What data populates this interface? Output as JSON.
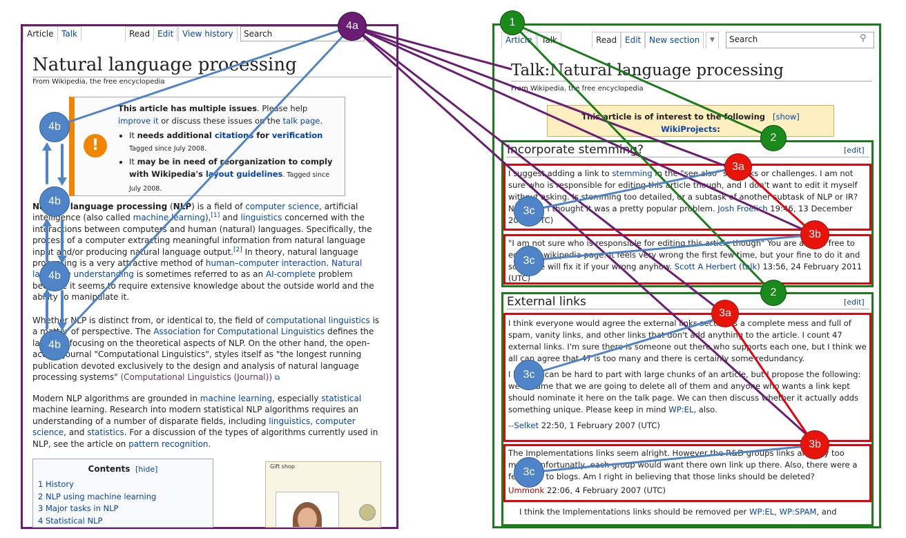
{
  "left": {
    "tabs": {
      "article": "Article",
      "talk": "Talk",
      "read": "Read",
      "edit": "Edit",
      "history": "View history"
    },
    "search_placeholder": "Search",
    "title": "Natural language processing",
    "subtitle": "From Wikipedia, the free encyclopedia",
    "issues": {
      "head_bold": "This article has multiple issues",
      "head_rest": ". Please help",
      "improve": "improve it",
      "or": " or discuss these issues on the ",
      "talk": "talk page",
      "dot": ".",
      "b1_a": "It ",
      "b1_b": "needs additional ",
      "b1_cit": "citations",
      "b1_for": " for ",
      "b1_ver": "verification",
      "b1_tag": "Tagged since July 2008.",
      "b2_a": "It ",
      "b2_b": "may be in need of reorganization to comply with Wikipedia's ",
      "b2_lay": "layout guidelines",
      "b2_tag": ". Tagged since July 2008."
    },
    "p1": {
      "t1": "Natural language processing",
      "t2": " (",
      "t3": "NLP",
      "t4": ") is a field of ",
      "cs": "computer science",
      "t5": ", artificial intelligence (also called ",
      "ml": "machine learning",
      "t6": "),",
      "ref1": "[1]",
      "t7": " and ",
      "ling": "linguistics",
      "t8": " concerned with the interactions between computers and human (natural) languages. Specifically, the process of a computer extracting meaningful information from natural language input and/or producing natural language output.",
      "ref2": "[2]",
      "t9": " In theory, natural language processing is a very attractive method of ",
      "hci": "human–computer interaction",
      "t10": ". ",
      "nlu": "Natural language understanding",
      "t11": " is sometimes referred to as an ",
      "aic": "AI-complete",
      "t12": " problem because it seems to require extensive knowledge about the outside world and the ability to manipulate it."
    },
    "p2": {
      "t1": "Whether NLP is distinct from, or identical to, the field of ",
      "cl": "computational linguistics",
      "t2": " is a matter of perspective. The ",
      "acl": "Association for Computational Linguistics",
      "t3": " defines the latter as focusing on the theoretical aspects of NLP. On the other hand, the open-access journal \"Computational Linguistics\", styles itself as \"the longest running publication devoted exclusively to the design and analysis of natural language processing systems\" ",
      "clj": "(Computational Linguistics (Journal))"
    },
    "p3": {
      "t1": "Modern NLP algorithms are grounded in ",
      "ml": "machine learning",
      "t2": ", especially ",
      "st": "statistical",
      "t3": " machine learning. Research into modern statistical NLP algorithms requires an understanding of a number of disparate fields, including ",
      "ling": "linguistics",
      "t4": ", ",
      "cs": "computer science",
      "t5": ", and ",
      "stats": "statistics",
      "t6": ". For a discussion of the types of algorithms currently used in NLP, see the article on ",
      "pr": "pattern recognition",
      "t7": "."
    },
    "toc": {
      "title": "Contents",
      "hide": "[hide]",
      "items": [
        "1 History",
        "2 NLP using machine learning",
        "3 Major tasks in NLP",
        "4 Statistical NLP"
      ]
    },
    "gift": {
      "title": "Gift shop"
    }
  },
  "right": {
    "tabs": {
      "article": "Article",
      "talk": "Talk",
      "read": "Read",
      "edit": "Edit",
      "newsec": "New section"
    },
    "search_placeholder": "Search",
    "title": "Talk:Natural language processing",
    "subtitle": "From Wikipedia, the free encyclopedia",
    "banner": {
      "text": "This article is of interest to the following",
      "show": "[show]",
      "wp": "WikiProjects",
      ":": ":"
    },
    "s1": {
      "title": "Incorporate stemming?",
      "edit": "[edit]",
      "c1": {
        "t1": "I suggest adding a link to ",
        "stem": "stemming",
        "t2": " in the \"see also\" subtasks or challenges. I am not sure who is responsible for editing this article though, and I don't want to edit it myself without asking. Is stemming too detailed, or a subtask of another subtask of NLP or IR? Not sure, I thought it was a pretty popular problem. ",
        "user": "Josh Froelich",
        "t3": " 19:46, 13 December 2006 (UTC)"
      },
      "c2": {
        "t1": "\"I am not sure who is responsible for editing this article though\" You are all feel free to edit any wikipedia page. It feels very wrong the first few time, but your fine to do it and someone will fix it if your wrong anyhow. ",
        "user": "Scott A Herbert",
        "t2": " (",
        "talk": "talk",
        "t3": ") 13:56, 24 February 2011 (UTC)"
      }
    },
    "s2": {
      "title": "External links",
      "edit": "[edit]",
      "c1": {
        "t1": "I think everyone would agree the external links section is a complete mess and full of spam, vanity links, and other links that don't add anything to the article. I count 47 external links. I'm sure there is someone out there who supports each one, but I think we all can agree that 47 is too many and there is certainly some redundancy.",
        "t2": "I know it can be hard to part with large chunks of an article, but I propose the following: we assume that we are going to delete all of them and anyone who wants a link kept should nominate it here on the talk page. We can then discuss whether it actually adds something unique. Please keep in mind ",
        "wpel": "WP:EL",
        "t3": ", also.",
        "sig_pre": "--",
        "user": "Selket",
        "t4": " 22:50, 1 February 2007 (UTC)"
      },
      "c2": {
        "t1": "The Implementations links seem alright. However the R&D groups links are way too many. Unfortunatly, each group would want there own link up there. Also, there were a few links to blogs. Am I right in believing that those links should be deleted?",
        "user": "Ummonk",
        "t2": " 22:06, 4 February 2007 (UTC)"
      },
      "c3": {
        "t1": "I think the Implementations links should be removed per ",
        "wpel": "WP:EL",
        "t2": ", ",
        "spam": "WP:SPAM",
        "t3": ", and"
      }
    }
  },
  "markers": {
    "m4a": "4a",
    "m4b": "4b",
    "m1": "1",
    "m2": "2",
    "m3a": "3a",
    "m3b": "3b",
    "m3c": "3c"
  },
  "colors": {
    "purple": "#6a1d72",
    "green": "#1a7d1a",
    "red": "#e8000b",
    "blue": "#4f85c8",
    "link": "#0645ad",
    "notice_bg": "#fbfbfb",
    "banner_bg": "#fdefbf"
  }
}
